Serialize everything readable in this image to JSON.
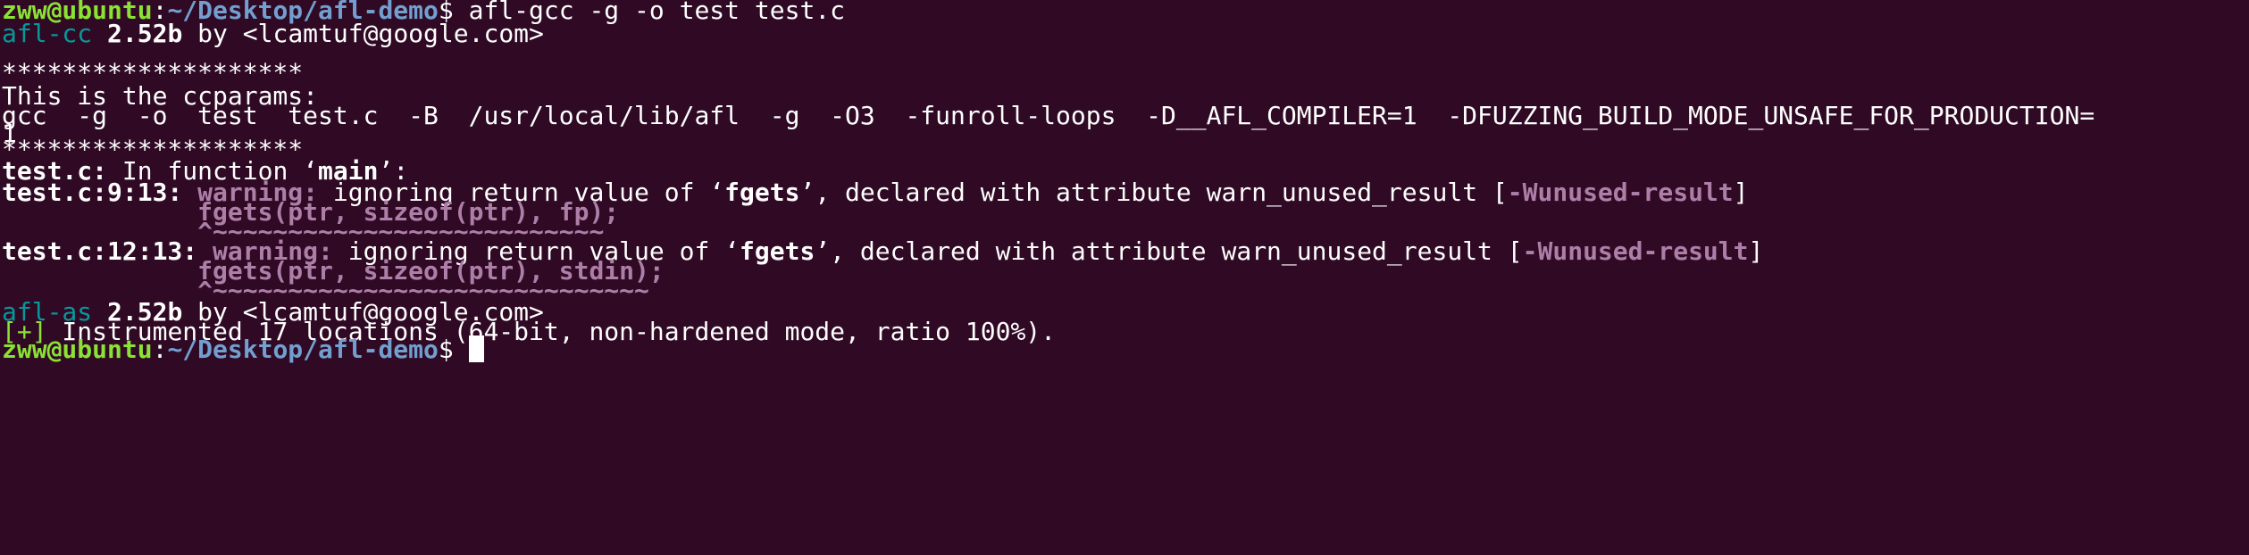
{
  "terminal": {
    "prompt": {
      "user_host": "zww@ubuntu",
      "sep": ":",
      "path": "~/Desktop/afl-demo",
      "symbol": "$",
      "command": " afl-gcc -g -o test test.c"
    },
    "afl_cc": {
      "name": "afl-cc",
      "sp": " ",
      "version": "2.52b",
      "rest": " by <lcamtuf@google.com>"
    },
    "stars1": "********************",
    "ccparams_label": "This is the ccparams:",
    "ccparams_line": "gcc  -g  -o  test  test.c  -B  /usr/local/lib/afl  -g  -O3  -funroll-loops  -D__AFL_COMPILER=1  -DFUZZING_BUILD_MODE_UNSAFE_FOR_PRODUCTION=",
    "ccparams_wrap": "1",
    "stars2": "********************",
    "infunc": {
      "file": "test.c:",
      "text": " In function ‘",
      "func": "main",
      "end": "’:"
    },
    "warn1": {
      "loc": "test.c:9:13:",
      "sp": " ",
      "label": "warning:",
      "msg": " ignoring return value of ‘",
      "func": "fgets",
      "msg2": "’, declared with attribute warn_unused_result [",
      "flag": "-Wunused-result",
      "close": "]",
      "code": "             fgets(ptr, sizeof(ptr), fp);",
      "caret": "             ^~~~~~~~~~~~~~~~~~~~~~~~~~~"
    },
    "warn2": {
      "loc": "test.c:12:13:",
      "sp": " ",
      "label": "warning:",
      "msg": " ignoring return value of ‘",
      "func": "fgets",
      "msg2": "’, declared with attribute warn_unused_result [",
      "flag": "-Wunused-result",
      "close": "]",
      "code": "             fgets(ptr, sizeof(ptr), stdin);",
      "caret": "             ^~~~~~~~~~~~~~~~~~~~~~~~~~~~~~"
    },
    "afl_as": {
      "name": "afl-as",
      "sp": " ",
      "version": "2.52b",
      "rest": " by <lcamtuf@google.com>"
    },
    "instrumented": {
      "tag": "[+]",
      "msg": " Instrumented 17 locations (64-bit, non-hardened mode, ratio 100%)."
    },
    "prompt2": {
      "user_host": "zww@ubuntu",
      "sep": ":",
      "path": "~/Desktop/afl-demo",
      "symbol": "$ "
    },
    "colors": {
      "background": "#300a24",
      "prompt_user": "#8ae234",
      "prompt_path": "#729fcf",
      "afl_tool": "#06989a",
      "warning": "#ad7fa8",
      "text": "#ffffff"
    }
  }
}
